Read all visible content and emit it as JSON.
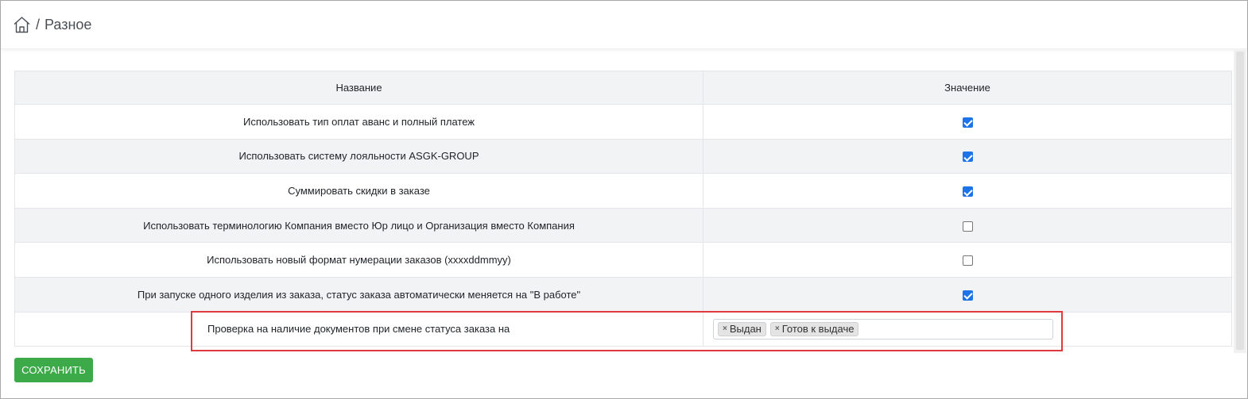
{
  "breadcrumb": {
    "separator": "/",
    "current": "Разное"
  },
  "table": {
    "headers": {
      "name": "Название",
      "value": "Значение"
    },
    "rows": [
      {
        "name": "Использовать тип оплат аванс и полный платеж",
        "checked": true
      },
      {
        "name": "Использовать систему лояльности ASGK-GROUP",
        "checked": true
      },
      {
        "name": "Суммировать скидки в заказе",
        "checked": true
      },
      {
        "name": "Использовать терминологию Компания вместо Юр лицо и Организация вместо Компания",
        "checked": false
      },
      {
        "name": "Использовать новый формат нумерации заказов (xxxxddmmyy)",
        "checked": false
      },
      {
        "name": "При запуске одного изделия из заказа, статус заказа автоматически меняется на \"В работе\"",
        "checked": true
      }
    ],
    "status_check_row": {
      "name": "Проверка на наличие документов при смене статуса заказа на",
      "tags": [
        "Выдан",
        "Готов к выдаче"
      ],
      "remove_glyph": "×"
    }
  },
  "actions": {
    "save_label": "СОХРАНИТЬ"
  },
  "colors": {
    "accent_green": "#3daa49",
    "checkbox_blue": "#1e74e6",
    "highlight_red": "#e0393e"
  },
  "icons": {
    "home": "home-icon"
  }
}
